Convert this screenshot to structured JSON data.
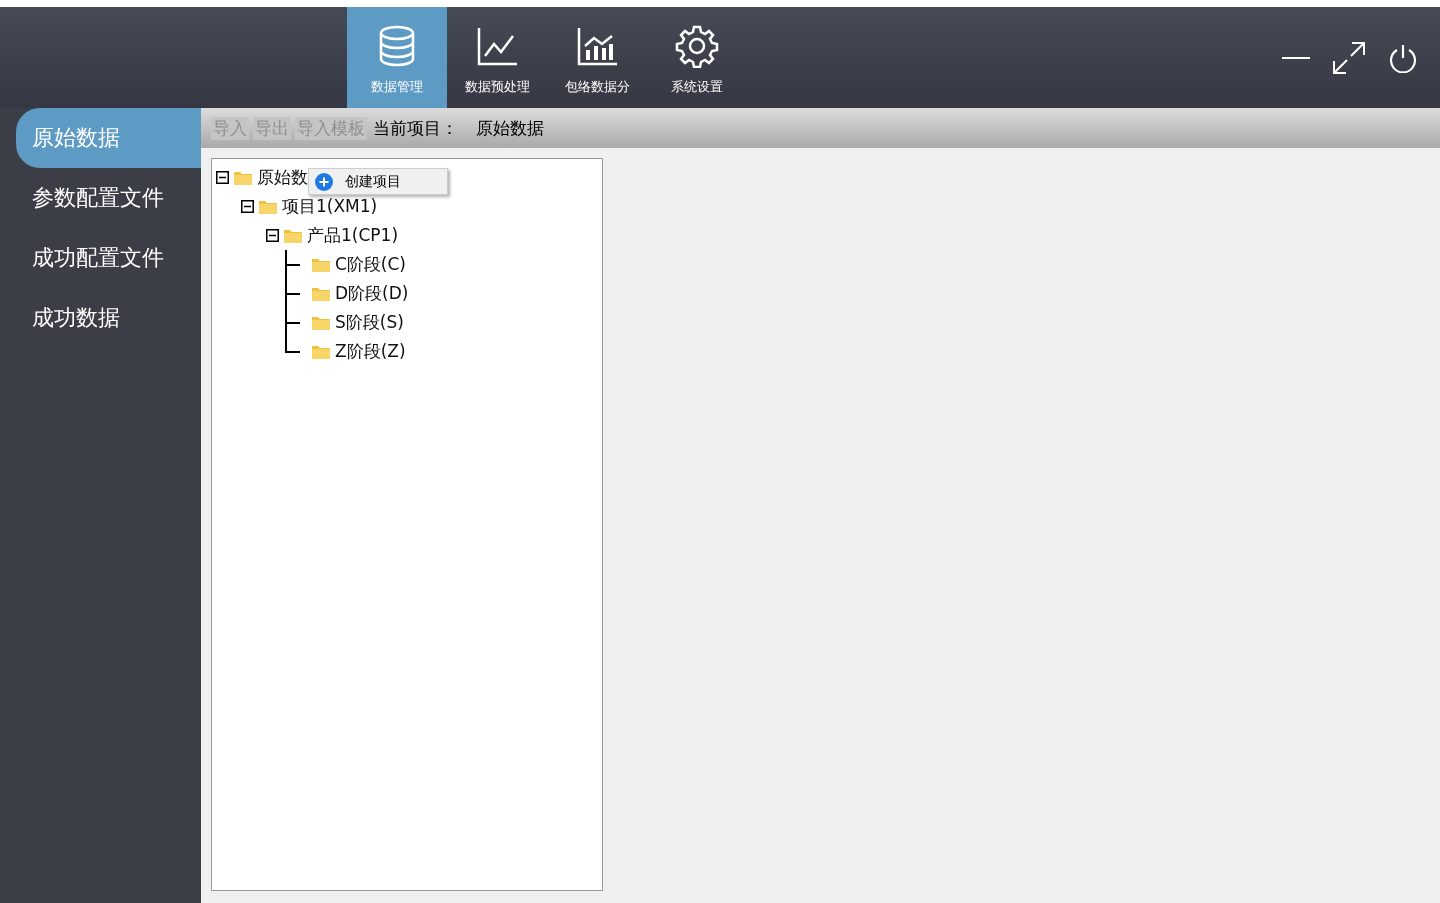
{
  "nav_tabs": [
    {
      "label": "数据管理",
      "kind": "database",
      "selected": true
    },
    {
      "label": "数据预处理",
      "kind": "line",
      "selected": false
    },
    {
      "label": "包络数据分",
      "kind": "bars",
      "selected": false
    },
    {
      "label": "系统设置",
      "kind": "gear",
      "selected": false
    }
  ],
  "sidebar": {
    "items": [
      {
        "label": "原始数据",
        "selected": true
      },
      {
        "label": "参数配置文件",
        "selected": false
      },
      {
        "label": "成功配置文件",
        "selected": false
      },
      {
        "label": "成功数据",
        "selected": false
      }
    ]
  },
  "toolbar": {
    "buttons": [
      {
        "label": "导入",
        "disabled": true
      },
      {
        "label": "导出",
        "disabled": true
      },
      {
        "label": "导入模板",
        "disabled": true
      }
    ],
    "current_label": "当前项目：",
    "current_value": "原始数据"
  },
  "tree": [
    {
      "label": "原始数",
      "expanded": true,
      "children": [
        {
          "label": "项目1(XM1)",
          "expanded": true,
          "children": [
            {
              "label": "产品1(CP1)",
              "expanded": true,
              "children": [
                {
                  "label": "C阶段(C)"
                },
                {
                  "label": "D阶段(D)"
                },
                {
                  "label": "S阶段(S)"
                },
                {
                  "label": "Z阶段(Z)"
                }
              ]
            }
          ]
        }
      ]
    }
  ],
  "context_menu": {
    "items": [
      {
        "label": "创建项目"
      }
    ]
  }
}
